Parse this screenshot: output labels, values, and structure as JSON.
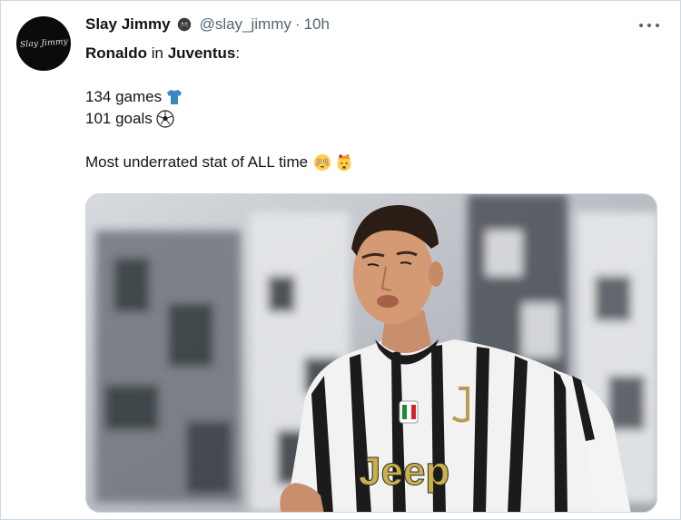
{
  "tweet": {
    "author_name": "Slay Jimmy",
    "handle": "@slay_jimmy",
    "separator": "·",
    "time": "10h",
    "avatar_text": "Slay Jimmy",
    "lines": {
      "l1_a": "Ronaldo",
      "l1_b": " in ",
      "l1_c": "Juventus",
      "l1_d": ":",
      "l2": "134 games",
      "l3": "101 goals",
      "l4": "Most underrated stat of ALL time"
    },
    "emojis": {
      "games": "t-shirt-icon",
      "goals": "soccer-ball-icon",
      "stat_1": "flushed-face-icon",
      "stat_2": "exploding-head-icon"
    },
    "image": {
      "jersey_sponsor": "Jeep"
    }
  },
  "colors": {
    "text": "#0f1419",
    "muted": "#536471",
    "border": "#cfd9de",
    "tshirt": "#3b88c3"
  }
}
